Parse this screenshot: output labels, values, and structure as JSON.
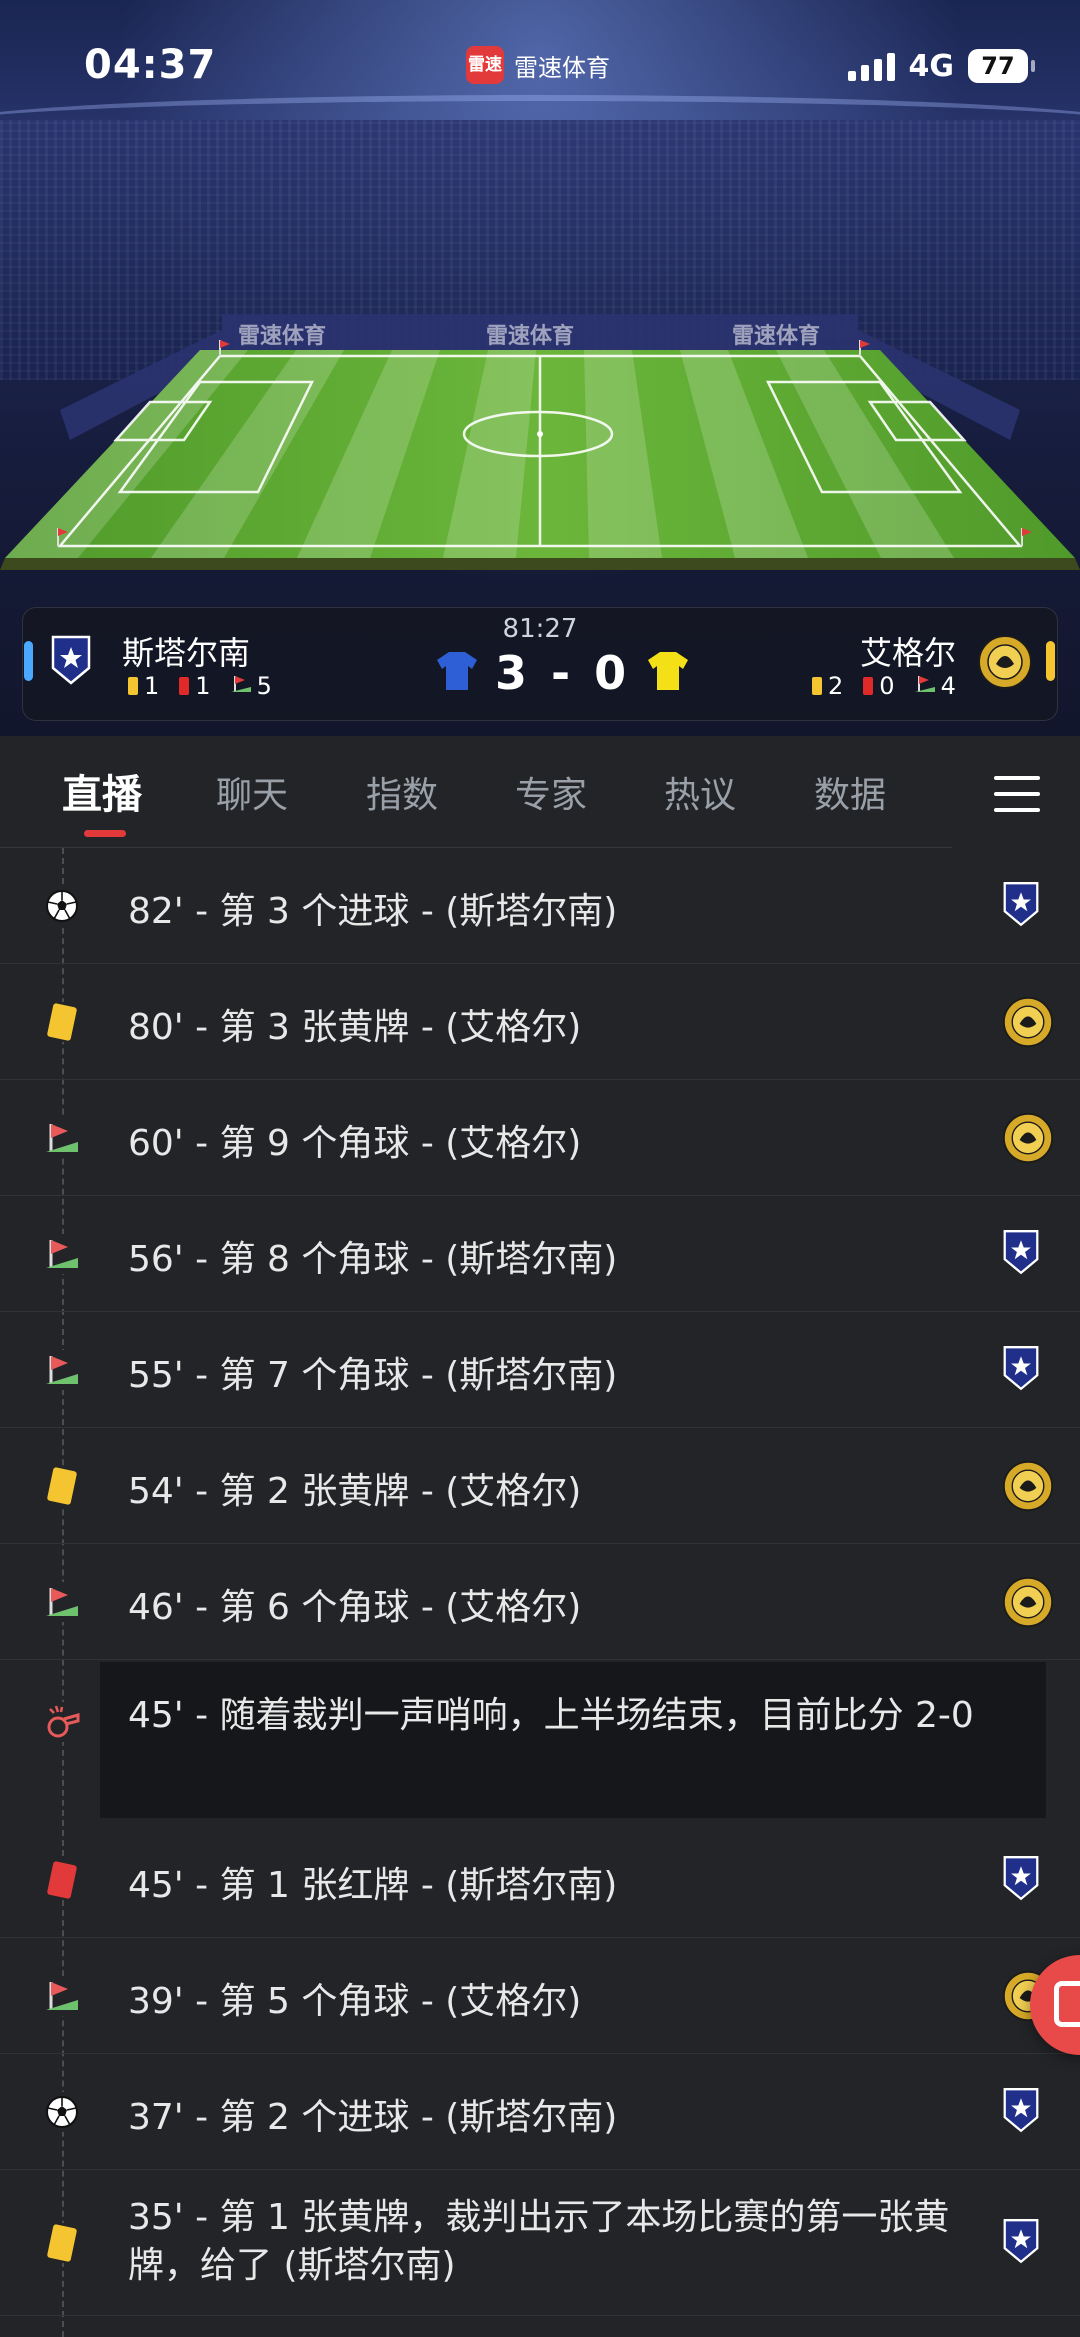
{
  "status_bar": {
    "time": "04:37",
    "app_logo_text": "雷速",
    "app_name": "雷速体育",
    "network": "4G",
    "battery": "77"
  },
  "stadium": {
    "board_texts": [
      "雷速体育",
      "雷速体育",
      "雷速体育"
    ]
  },
  "match": {
    "time": "81:27",
    "score": "3 - 0",
    "home": {
      "name": "斯塔尔南",
      "yellow": "1",
      "red": "1",
      "corners": "5",
      "color": "#2f5fd6",
      "crest": "shield-star-crest"
    },
    "away": {
      "name": "艾格尔",
      "yellow": "2",
      "red": "0",
      "corners": "4",
      "color": "#f4e017",
      "crest": "gold-round-crest"
    }
  },
  "tabs": [
    "直播",
    "聊天",
    "指数",
    "专家",
    "热议",
    "数据"
  ],
  "active_tab": "直播",
  "events": [
    {
      "icon": "soccer-ball-icon",
      "text": "82' - 第 3 个进球 - (斯塔尔南)",
      "team": "home"
    },
    {
      "icon": "yellow-card-icon",
      "text": "80' - 第 3 张黄牌 - (艾格尔)",
      "team": "away"
    },
    {
      "icon": "corner-flag-icon",
      "text": "60' - 第 9 个角球 - (艾格尔)",
      "team": "away"
    },
    {
      "icon": "corner-flag-icon",
      "text": "56' - 第 8 个角球 - (斯塔尔南)",
      "team": "home"
    },
    {
      "icon": "corner-flag-icon",
      "text": "55' - 第 7 个角球 - (斯塔尔南)",
      "team": "home"
    },
    {
      "icon": "yellow-card-icon",
      "text": "54' - 第 2 张黄牌 - (艾格尔)",
      "team": "away"
    },
    {
      "icon": "corner-flag-icon",
      "text": "46' - 第 6 个角球 - (艾格尔)",
      "team": "away"
    },
    {
      "icon": "whistle-icon",
      "text": "45' - 随着裁判一声哨响，上半场结束，目前比分 2-0",
      "team": ""
    },
    {
      "icon": "red-card-icon",
      "text": "45' - 第 1 张红牌 - (斯塔尔南)",
      "team": "home"
    },
    {
      "icon": "corner-flag-icon",
      "text": "39' - 第 5 个角球 - (艾格尔)",
      "team": "away"
    },
    {
      "icon": "soccer-ball-icon",
      "text": "37' - 第 2 个进球 - (斯塔尔南)",
      "team": "home"
    },
    {
      "icon": "yellow-card-icon",
      "text": "35' - 第 1 张黄牌，裁判出示了本场比赛的第一张黄牌，给了 (斯塔尔南)",
      "team": "home"
    }
  ],
  "colors": {
    "accent": "#e23a3a",
    "background": "#222427",
    "yellow_card": "#f4c431",
    "red_card": "#e23a3a",
    "home_indicator": "#4aa8ff",
    "away_indicator": "#f4c431"
  }
}
